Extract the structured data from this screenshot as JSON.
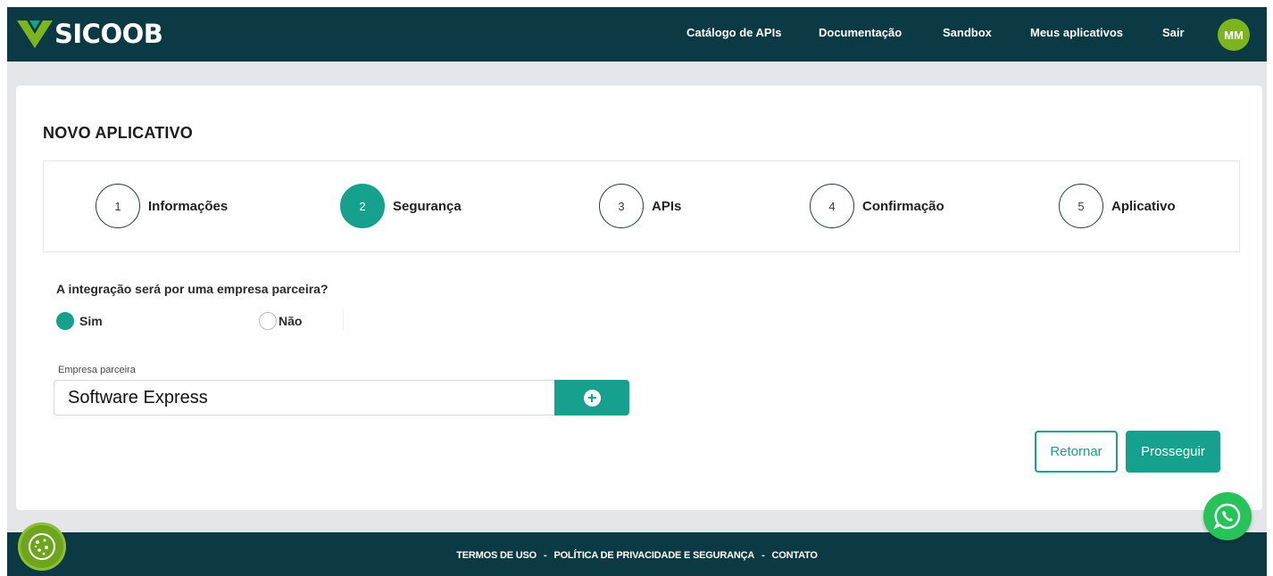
{
  "brand": {
    "name": "SICOOB"
  },
  "nav": {
    "items": [
      {
        "label": "Catálogo de APIs"
      },
      {
        "label": "Documentação"
      },
      {
        "label": "Sandbox"
      },
      {
        "label": "Meus aplicativos"
      },
      {
        "label": "Sair"
      }
    ],
    "avatar_initials": "MM"
  },
  "page": {
    "title": "NOVO APLICATIVO"
  },
  "stepper": {
    "active_step": 2,
    "steps": [
      {
        "number": "1",
        "label": "Informações"
      },
      {
        "number": "2",
        "label": "Segurança"
      },
      {
        "number": "3",
        "label": "APIs"
      },
      {
        "number": "4",
        "label": "Confirmação"
      },
      {
        "number": "5",
        "label": "Aplicativo"
      }
    ]
  },
  "form": {
    "question": "A integração será por uma empresa parceira?",
    "options": [
      {
        "label": "Sim",
        "selected": true
      },
      {
        "label": "Não",
        "selected": false
      }
    ],
    "partner_label": "Empresa parceira",
    "partner_value": "Software Express"
  },
  "actions": {
    "back_label": "Retornar",
    "next_label": "Prosseguir"
  },
  "footer": {
    "links": [
      "TERMOS DE USO",
      "POLÍTICA DE PRIVACIDADE E SEGURANÇA",
      "CONTATO"
    ],
    "separator": "-"
  },
  "icons": {
    "add": "plus-circle-icon",
    "cookie": "cookie-icon",
    "chat": "whatsapp-icon"
  },
  "colors": {
    "header_bg": "#0c3a44",
    "accent": "#15a18d",
    "avatar_bg": "#7db61c",
    "logo_green": "#7db61c",
    "page_bg": "#e4e6e9"
  }
}
